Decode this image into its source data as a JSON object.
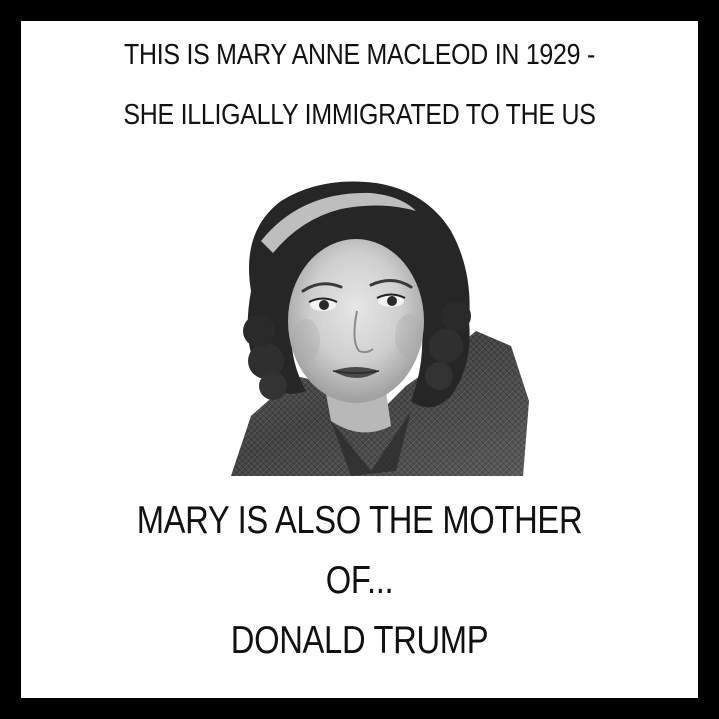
{
  "header": {
    "line1": "THIS IS MARY ANNE MACLEOD IN 1929 -",
    "line2": "SHE ILLIGALLY IMMIGRATED TO THE US"
  },
  "footer": {
    "line1": "MARY IS ALSO THE MOTHER",
    "line2": "OF...",
    "line3": "DONALD TRUMP"
  },
  "colors": {
    "border": "#000000",
    "background": "#ffffff",
    "text": "#111111"
  }
}
